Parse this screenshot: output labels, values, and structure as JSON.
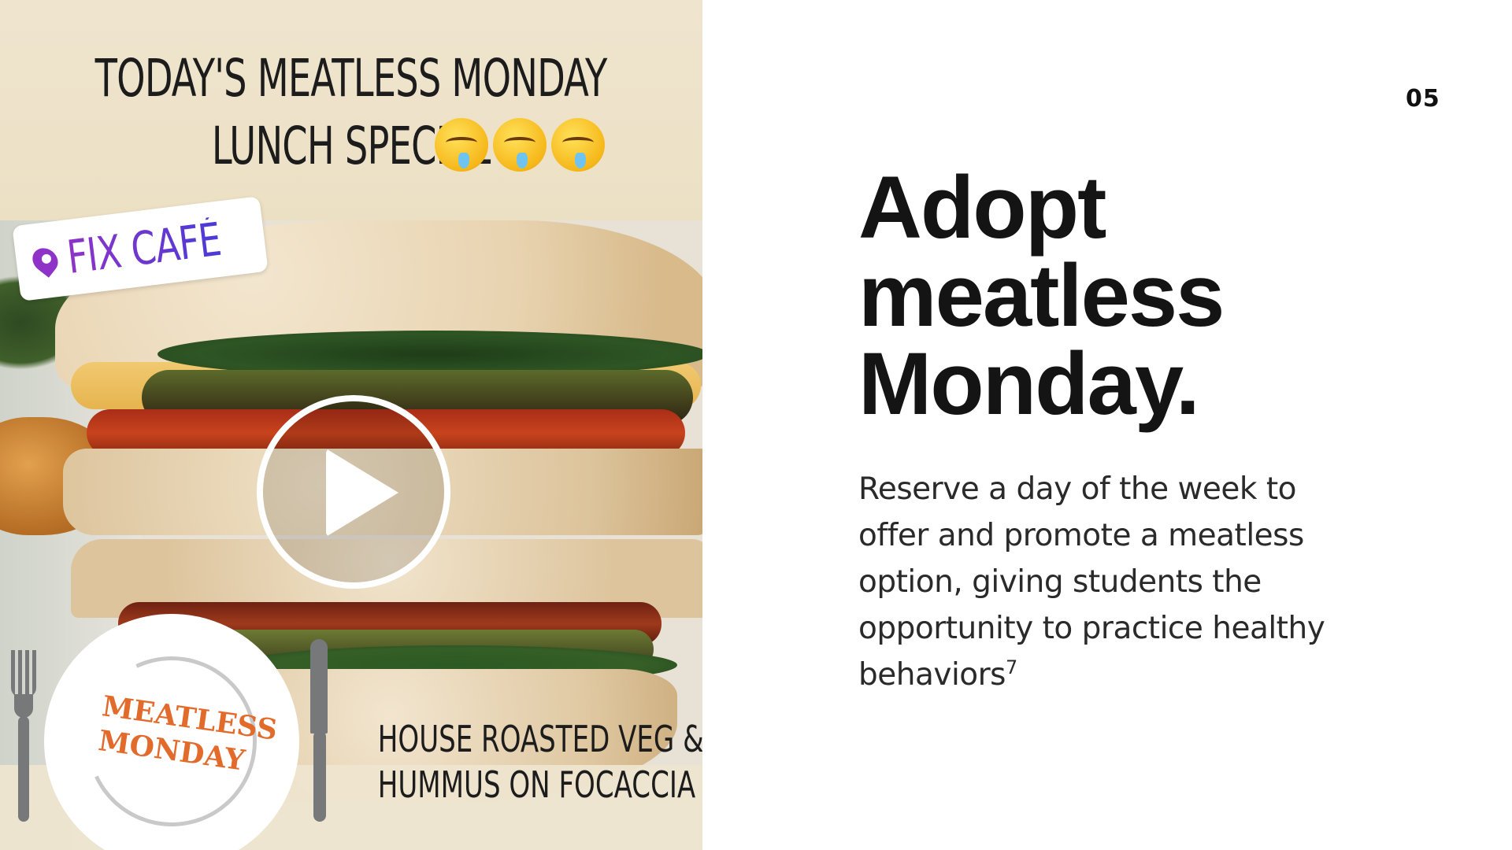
{
  "media": {
    "headline_line_1": "TODAY'S MEATLESS MONDAY",
    "headline_line_2": "LUNCH SPECIAL",
    "emojis": [
      "drooling-face",
      "drooling-face",
      "drooling-face"
    ],
    "location_sticker": "FIX CAFÉ",
    "logo_line_1": "MEATLESS",
    "logo_line_2": "MONDAY",
    "caption_line_1": "HOUSE ROASTED VEG &",
    "caption_line_2": "HUMMUS ON FOCACCIA",
    "play_icon": "play-icon"
  },
  "slide": {
    "number": "05",
    "title_line_1": "Adopt",
    "title_line_2": "meatless",
    "title_line_3": "Monday.",
    "body": "Reserve a day of the week to offer and promote a meatless option, giving students the opportunity to practice healthy behaviors",
    "footnote": "7"
  },
  "colors": {
    "location_purple": "#6a35d9",
    "logo_orange": "#e26b2c",
    "panel_cream": "#efe4cb",
    "text_dark": "#141414"
  }
}
